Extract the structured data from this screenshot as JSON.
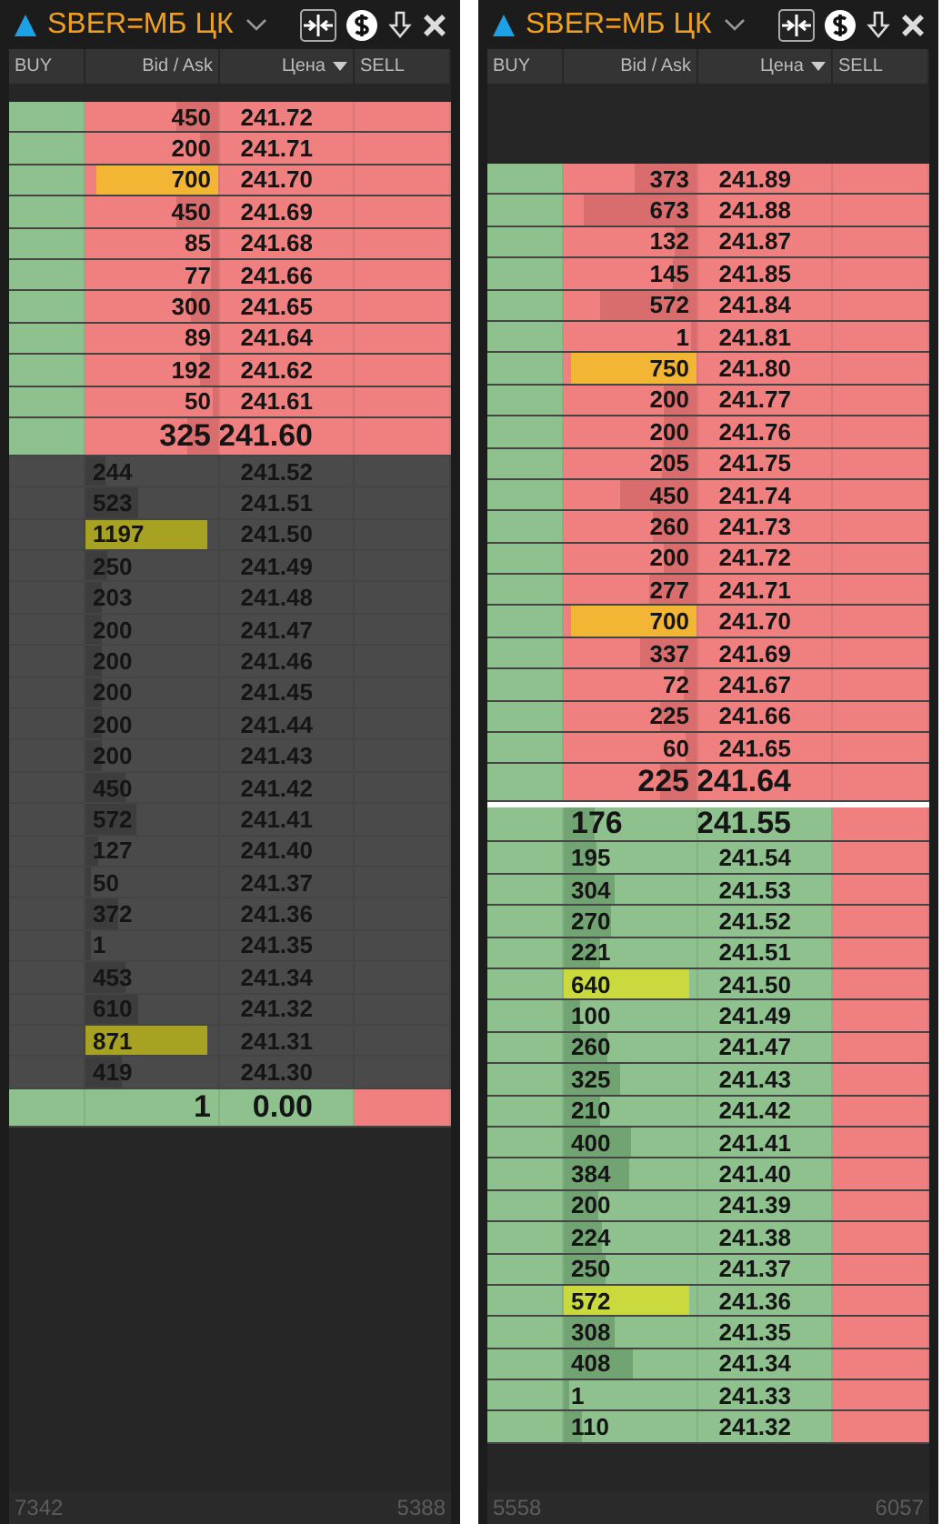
{
  "panels": [
    {
      "title": "SBER=МБ ЦК",
      "columns": [
        "BUY",
        "Bid / Ask",
        "Цена",
        "SELL"
      ],
      "footer": {
        "buy_total": "7342",
        "sell_total": "5388"
      },
      "rows": [
        {
          "kind": "ask",
          "qty": "450",
          "price": "241.72",
          "level": 0.32,
          "highlight": false,
          "best": false
        },
        {
          "kind": "ask",
          "qty": "200",
          "price": "241.71",
          "level": 0.14,
          "highlight": false,
          "best": false
        },
        {
          "kind": "ask",
          "qty": "700",
          "price": "241.70",
          "level": 0.92,
          "highlight": true,
          "best": false
        },
        {
          "kind": "ask",
          "qty": "450",
          "price": "241.69",
          "level": 0.32,
          "highlight": false,
          "best": false
        },
        {
          "kind": "ask",
          "qty": "85",
          "price": "241.68",
          "level": 0.06,
          "highlight": false,
          "best": false
        },
        {
          "kind": "ask",
          "qty": "77",
          "price": "241.66",
          "level": 0.06,
          "highlight": false,
          "best": false
        },
        {
          "kind": "ask",
          "qty": "300",
          "price": "241.65",
          "level": 0.21,
          "highlight": false,
          "best": false
        },
        {
          "kind": "ask",
          "qty": "89",
          "price": "241.64",
          "level": 0.06,
          "highlight": false,
          "best": false
        },
        {
          "kind": "ask",
          "qty": "192",
          "price": "241.62",
          "level": 0.14,
          "highlight": false,
          "best": false
        },
        {
          "kind": "ask",
          "qty": "50",
          "price": "241.61",
          "level": 0.04,
          "highlight": false,
          "best": false
        },
        {
          "kind": "ask",
          "qty": "325",
          "price": "241.60",
          "level": 0.23,
          "highlight": false,
          "best": true
        },
        {
          "kind": "muted",
          "qty": "244",
          "price": "241.52",
          "level": 0.15,
          "highlight": false,
          "best": false
        },
        {
          "kind": "muted",
          "qty": "523",
          "price": "241.51",
          "level": 0.4,
          "highlight": false,
          "best": false
        },
        {
          "kind": "muted",
          "qty": "1197",
          "price": "241.50",
          "level": 0.92,
          "highlight": true,
          "best": false
        },
        {
          "kind": "muted",
          "qty": "250",
          "price": "241.49",
          "level": 0.16,
          "highlight": false,
          "best": false
        },
        {
          "kind": "muted",
          "qty": "203",
          "price": "241.48",
          "level": 0.13,
          "highlight": false,
          "best": false
        },
        {
          "kind": "muted",
          "qty": "200",
          "price": "241.47",
          "level": 0.13,
          "highlight": false,
          "best": false
        },
        {
          "kind": "muted",
          "qty": "200",
          "price": "241.46",
          "level": 0.13,
          "highlight": false,
          "best": false
        },
        {
          "kind": "muted",
          "qty": "200",
          "price": "241.45",
          "level": 0.13,
          "highlight": false,
          "best": false
        },
        {
          "kind": "muted",
          "qty": "200",
          "price": "241.44",
          "level": 0.13,
          "highlight": false,
          "best": false
        },
        {
          "kind": "muted",
          "qty": "200",
          "price": "241.43",
          "level": 0.13,
          "highlight": false,
          "best": false
        },
        {
          "kind": "muted",
          "qty": "450",
          "price": "241.42",
          "level": 0.3,
          "highlight": false,
          "best": false
        },
        {
          "kind": "muted",
          "qty": "572",
          "price": "241.41",
          "level": 0.38,
          "highlight": false,
          "best": false
        },
        {
          "kind": "muted",
          "qty": "127",
          "price": "241.40",
          "level": 0.09,
          "highlight": false,
          "best": false
        },
        {
          "kind": "muted",
          "qty": "50",
          "price": "241.37",
          "level": 0.04,
          "highlight": false,
          "best": false
        },
        {
          "kind": "muted",
          "qty": "372",
          "price": "241.36",
          "level": 0.25,
          "highlight": false,
          "best": false
        },
        {
          "kind": "muted",
          "qty": "1",
          "price": "241.35",
          "level": 0.01,
          "highlight": false,
          "best": false
        },
        {
          "kind": "muted",
          "qty": "453",
          "price": "241.34",
          "level": 0.3,
          "highlight": false,
          "best": false
        },
        {
          "kind": "muted",
          "qty": "610",
          "price": "241.32",
          "level": 0.4,
          "highlight": false,
          "best": false
        },
        {
          "kind": "muted",
          "qty": "871",
          "price": "241.31",
          "level": 0.92,
          "highlight": true,
          "best": false
        },
        {
          "kind": "muted",
          "qty": "419",
          "price": "241.30",
          "level": 0.28,
          "highlight": false,
          "best": false
        },
        {
          "kind": "last",
          "qty": "1",
          "price": "0.00",
          "best": true
        }
      ]
    },
    {
      "title": "SBER=МБ ЦК",
      "columns": [
        "BUY",
        "Bid / Ask",
        "Цена",
        "SELL"
      ],
      "footer": {
        "buy_total": "5558",
        "sell_total": "6057"
      },
      "rows": [
        {
          "kind": "ask",
          "qty": "373",
          "price": "241.89",
          "level": 0.47,
          "highlight": false,
          "best": false
        },
        {
          "kind": "ask",
          "qty": "673",
          "price": "241.88",
          "level": 0.85,
          "highlight": false,
          "best": false
        },
        {
          "kind": "ask",
          "qty": "132",
          "price": "241.87",
          "level": 0.17,
          "highlight": false,
          "best": false
        },
        {
          "kind": "ask",
          "qty": "145",
          "price": "241.85",
          "level": 0.18,
          "highlight": false,
          "best": false
        },
        {
          "kind": "ask",
          "qty": "572",
          "price": "241.84",
          "level": 0.72,
          "highlight": false,
          "best": false
        },
        {
          "kind": "ask",
          "qty": "1",
          "price": "241.81",
          "level": 0.01,
          "highlight": false,
          "best": false
        },
        {
          "kind": "ask",
          "qty": "750",
          "price": "241.80",
          "level": 0.95,
          "highlight": true,
          "best": false
        },
        {
          "kind": "ask",
          "qty": "200",
          "price": "241.77",
          "level": 0.25,
          "highlight": false,
          "best": false
        },
        {
          "kind": "ask",
          "qty": "200",
          "price": "241.76",
          "level": 0.25,
          "highlight": false,
          "best": false
        },
        {
          "kind": "ask",
          "qty": "205",
          "price": "241.75",
          "level": 0.26,
          "highlight": false,
          "best": false
        },
        {
          "kind": "ask",
          "qty": "450",
          "price": "241.74",
          "level": 0.57,
          "highlight": false,
          "best": false
        },
        {
          "kind": "ask",
          "qty": "260",
          "price": "241.73",
          "level": 0.33,
          "highlight": false,
          "best": false
        },
        {
          "kind": "ask",
          "qty": "200",
          "price": "241.72",
          "level": 0.25,
          "highlight": false,
          "best": false
        },
        {
          "kind": "ask",
          "qty": "277",
          "price": "241.71",
          "level": 0.35,
          "highlight": false,
          "best": false
        },
        {
          "kind": "ask",
          "qty": "700",
          "price": "241.70",
          "level": 0.95,
          "highlight": true,
          "best": false
        },
        {
          "kind": "ask",
          "qty": "337",
          "price": "241.69",
          "level": 0.43,
          "highlight": false,
          "best": false
        },
        {
          "kind": "ask",
          "qty": "72",
          "price": "241.67",
          "level": 0.09,
          "highlight": false,
          "best": false
        },
        {
          "kind": "ask",
          "qty": "225",
          "price": "241.66",
          "level": 0.28,
          "highlight": false,
          "best": false
        },
        {
          "kind": "ask",
          "qty": "60",
          "price": "241.65",
          "level": 0.08,
          "highlight": false,
          "best": false
        },
        {
          "kind": "ask",
          "qty": "225",
          "price": "241.64",
          "level": 0.28,
          "highlight": false,
          "best": true
        },
        {
          "kind": "bid",
          "qty": "176",
          "price": "241.55",
          "level": 0.23,
          "highlight": false,
          "best": true
        },
        {
          "kind": "bid",
          "qty": "195",
          "price": "241.54",
          "level": 0.25,
          "highlight": false,
          "best": false
        },
        {
          "kind": "bid",
          "qty": "304",
          "price": "241.53",
          "level": 0.39,
          "highlight": false,
          "best": false
        },
        {
          "kind": "bid",
          "qty": "270",
          "price": "241.52",
          "level": 0.35,
          "highlight": false,
          "best": false
        },
        {
          "kind": "bid",
          "qty": "221",
          "price": "241.51",
          "level": 0.28,
          "highlight": false,
          "best": false
        },
        {
          "kind": "bid",
          "qty": "640",
          "price": "241.50",
          "level": 0.95,
          "highlight": true,
          "best": false
        },
        {
          "kind": "bid",
          "qty": "100",
          "price": "241.49",
          "level": 0.13,
          "highlight": false,
          "best": false
        },
        {
          "kind": "bid",
          "qty": "260",
          "price": "241.47",
          "level": 0.33,
          "highlight": false,
          "best": false
        },
        {
          "kind": "bid",
          "qty": "325",
          "price": "241.43",
          "level": 0.42,
          "highlight": false,
          "best": false
        },
        {
          "kind": "bid",
          "qty": "210",
          "price": "241.42",
          "level": 0.27,
          "highlight": false,
          "best": false
        },
        {
          "kind": "bid",
          "qty": "400",
          "price": "241.41",
          "level": 0.51,
          "highlight": false,
          "best": false
        },
        {
          "kind": "bid",
          "qty": "384",
          "price": "241.40",
          "level": 0.49,
          "highlight": false,
          "best": false
        },
        {
          "kind": "bid",
          "qty": "200",
          "price": "241.39",
          "level": 0.26,
          "highlight": false,
          "best": false
        },
        {
          "kind": "bid",
          "qty": "224",
          "price": "241.38",
          "level": 0.29,
          "highlight": false,
          "best": false
        },
        {
          "kind": "bid",
          "qty": "250",
          "price": "241.37",
          "level": 0.32,
          "highlight": false,
          "best": false
        },
        {
          "kind": "bid",
          "qty": "572",
          "price": "241.36",
          "level": 0.95,
          "highlight": true,
          "best": false
        },
        {
          "kind": "bid",
          "qty": "308",
          "price": "241.35",
          "level": 0.39,
          "highlight": false,
          "best": false
        },
        {
          "kind": "bid",
          "qty": "408",
          "price": "241.34",
          "level": 0.52,
          "highlight": false,
          "best": false
        },
        {
          "kind": "bid",
          "qty": "1",
          "price": "241.33",
          "level": 0.01,
          "highlight": false,
          "best": false
        },
        {
          "kind": "bid",
          "qty": "110",
          "price": "241.32",
          "level": 0.14,
          "highlight": false,
          "best": false
        }
      ]
    }
  ]
}
